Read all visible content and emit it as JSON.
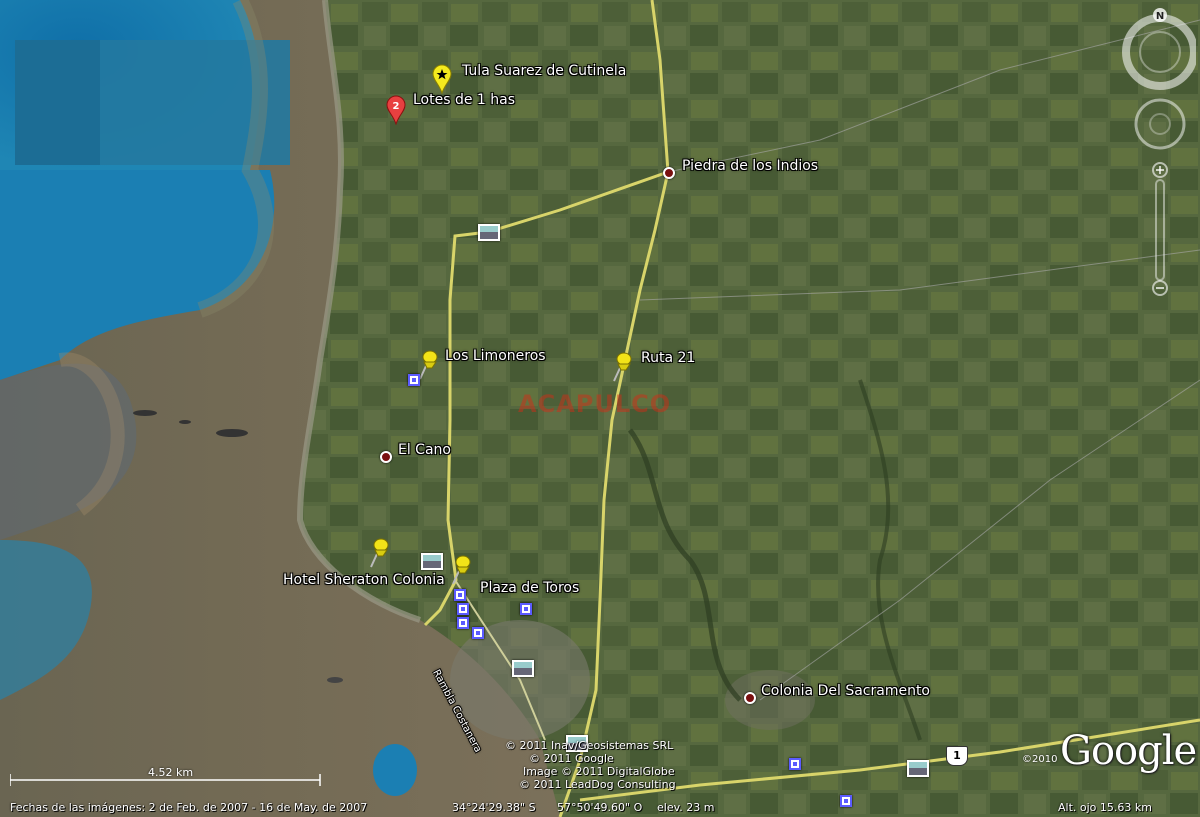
{
  "places": {
    "tula": "Tula Suarez de Cutinela",
    "lotes": "Lotes de 1 has",
    "lotes_badge": "2",
    "piedra": "Piedra de los Indios",
    "limoneros": "Los Limoneros",
    "ruta21": "Ruta 21",
    "elcano": "El Cano",
    "sheraton": "Hotel Sheraton Colonia",
    "toros": "Plaza de Toros",
    "colonia": "Colonia Del Sacramento",
    "rambla": "Rambla Costanera"
  },
  "watermark": "ACAPULCO",
  "route_shield": "1",
  "credits": {
    "line1": "© 2011 Inav/Geosistemas SRL",
    "line2": "© 2011 Google",
    "line3": "Image © 2011 DigitalGlobe",
    "line4": "© 2011 LeadDog Consulting"
  },
  "copyright_2010": "©2010",
  "logo": "Google",
  "scale": "4.52 km",
  "status": {
    "dates": "Fechas de las imágenes:  2 de Feb. de 2007 - 16 de May. de 2007",
    "lat": "34°24'29.38\" S",
    "lon": "57°50'49.60\" O",
    "elev": "elev.   23 m",
    "alt": "Alt. ojo   15.63 km"
  },
  "nav": {
    "north": "N"
  },
  "colors": {
    "water": "#1a6f9e",
    "road": "#d8d46a",
    "land": "#556640",
    "pushpin": "#f2e318"
  }
}
